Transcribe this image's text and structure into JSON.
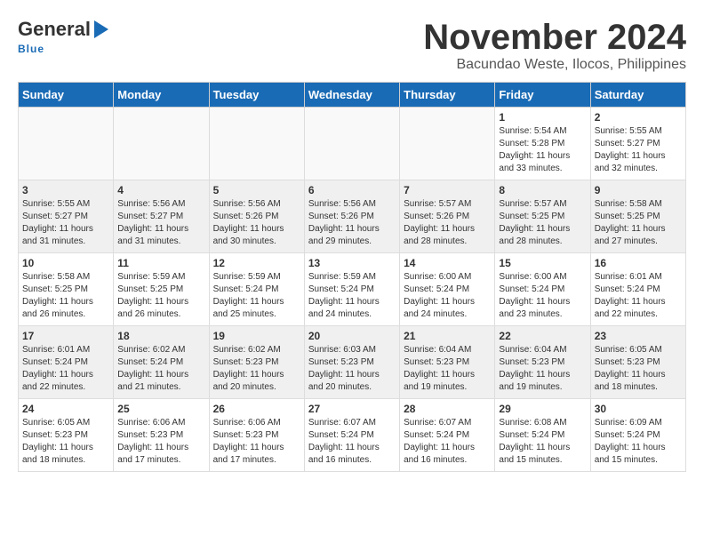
{
  "header": {
    "logo_line1": "General",
    "logo_line2": "Blue",
    "month": "November 2024",
    "location": "Bacundao Weste, Ilocos, Philippines"
  },
  "weekdays": [
    "Sunday",
    "Monday",
    "Tuesday",
    "Wednesday",
    "Thursday",
    "Friday",
    "Saturday"
  ],
  "weeks": [
    [
      {
        "day": "",
        "info": ""
      },
      {
        "day": "",
        "info": ""
      },
      {
        "day": "",
        "info": ""
      },
      {
        "day": "",
        "info": ""
      },
      {
        "day": "",
        "info": ""
      },
      {
        "day": "1",
        "info": "Sunrise: 5:54 AM\nSunset: 5:28 PM\nDaylight: 11 hours and 33 minutes."
      },
      {
        "day": "2",
        "info": "Sunrise: 5:55 AM\nSunset: 5:27 PM\nDaylight: 11 hours and 32 minutes."
      }
    ],
    [
      {
        "day": "3",
        "info": "Sunrise: 5:55 AM\nSunset: 5:27 PM\nDaylight: 11 hours and 31 minutes."
      },
      {
        "day": "4",
        "info": "Sunrise: 5:56 AM\nSunset: 5:27 PM\nDaylight: 11 hours and 31 minutes."
      },
      {
        "day": "5",
        "info": "Sunrise: 5:56 AM\nSunset: 5:26 PM\nDaylight: 11 hours and 30 minutes."
      },
      {
        "day": "6",
        "info": "Sunrise: 5:56 AM\nSunset: 5:26 PM\nDaylight: 11 hours and 29 minutes."
      },
      {
        "day": "7",
        "info": "Sunrise: 5:57 AM\nSunset: 5:26 PM\nDaylight: 11 hours and 28 minutes."
      },
      {
        "day": "8",
        "info": "Sunrise: 5:57 AM\nSunset: 5:25 PM\nDaylight: 11 hours and 28 minutes."
      },
      {
        "day": "9",
        "info": "Sunrise: 5:58 AM\nSunset: 5:25 PM\nDaylight: 11 hours and 27 minutes."
      }
    ],
    [
      {
        "day": "10",
        "info": "Sunrise: 5:58 AM\nSunset: 5:25 PM\nDaylight: 11 hours and 26 minutes."
      },
      {
        "day": "11",
        "info": "Sunrise: 5:59 AM\nSunset: 5:25 PM\nDaylight: 11 hours and 26 minutes."
      },
      {
        "day": "12",
        "info": "Sunrise: 5:59 AM\nSunset: 5:24 PM\nDaylight: 11 hours and 25 minutes."
      },
      {
        "day": "13",
        "info": "Sunrise: 5:59 AM\nSunset: 5:24 PM\nDaylight: 11 hours and 24 minutes."
      },
      {
        "day": "14",
        "info": "Sunrise: 6:00 AM\nSunset: 5:24 PM\nDaylight: 11 hours and 24 minutes."
      },
      {
        "day": "15",
        "info": "Sunrise: 6:00 AM\nSunset: 5:24 PM\nDaylight: 11 hours and 23 minutes."
      },
      {
        "day": "16",
        "info": "Sunrise: 6:01 AM\nSunset: 5:24 PM\nDaylight: 11 hours and 22 minutes."
      }
    ],
    [
      {
        "day": "17",
        "info": "Sunrise: 6:01 AM\nSunset: 5:24 PM\nDaylight: 11 hours and 22 minutes."
      },
      {
        "day": "18",
        "info": "Sunrise: 6:02 AM\nSunset: 5:24 PM\nDaylight: 11 hours and 21 minutes."
      },
      {
        "day": "19",
        "info": "Sunrise: 6:02 AM\nSunset: 5:23 PM\nDaylight: 11 hours and 20 minutes."
      },
      {
        "day": "20",
        "info": "Sunrise: 6:03 AM\nSunset: 5:23 PM\nDaylight: 11 hours and 20 minutes."
      },
      {
        "day": "21",
        "info": "Sunrise: 6:04 AM\nSunset: 5:23 PM\nDaylight: 11 hours and 19 minutes."
      },
      {
        "day": "22",
        "info": "Sunrise: 6:04 AM\nSunset: 5:23 PM\nDaylight: 11 hours and 19 minutes."
      },
      {
        "day": "23",
        "info": "Sunrise: 6:05 AM\nSunset: 5:23 PM\nDaylight: 11 hours and 18 minutes."
      }
    ],
    [
      {
        "day": "24",
        "info": "Sunrise: 6:05 AM\nSunset: 5:23 PM\nDaylight: 11 hours and 18 minutes."
      },
      {
        "day": "25",
        "info": "Sunrise: 6:06 AM\nSunset: 5:23 PM\nDaylight: 11 hours and 17 minutes."
      },
      {
        "day": "26",
        "info": "Sunrise: 6:06 AM\nSunset: 5:23 PM\nDaylight: 11 hours and 17 minutes."
      },
      {
        "day": "27",
        "info": "Sunrise: 6:07 AM\nSunset: 5:24 PM\nDaylight: 11 hours and 16 minutes."
      },
      {
        "day": "28",
        "info": "Sunrise: 6:07 AM\nSunset: 5:24 PM\nDaylight: 11 hours and 16 minutes."
      },
      {
        "day": "29",
        "info": "Sunrise: 6:08 AM\nSunset: 5:24 PM\nDaylight: 11 hours and 15 minutes."
      },
      {
        "day": "30",
        "info": "Sunrise: 6:09 AM\nSunset: 5:24 PM\nDaylight: 11 hours and 15 minutes."
      }
    ]
  ]
}
